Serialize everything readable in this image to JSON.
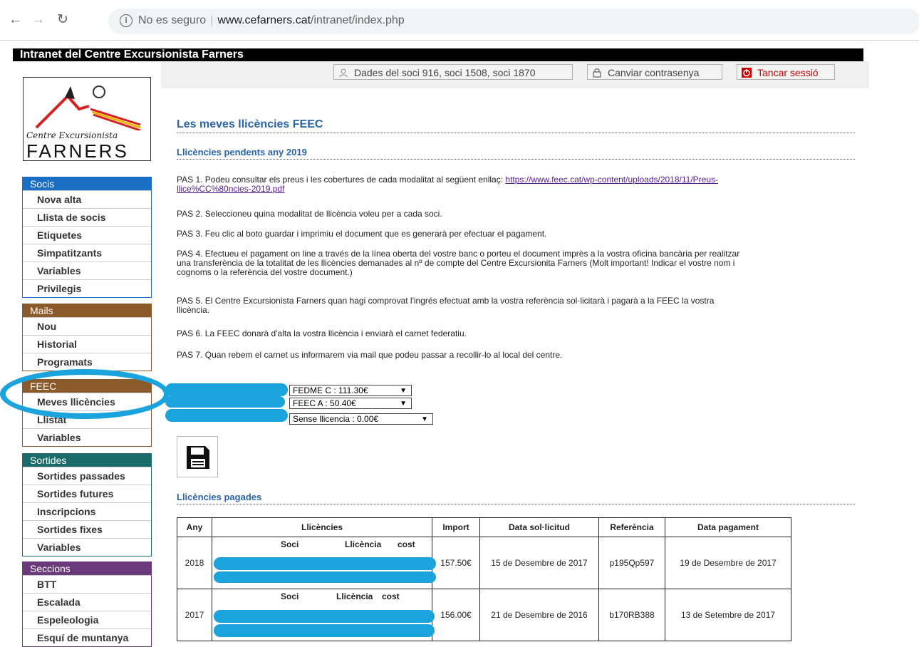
{
  "browser": {
    "security_label": "No es seguro",
    "url_host": "www.cefarners.cat",
    "url_path": "/intranet/index.php"
  },
  "app": {
    "title": "Intranet del Centre Excursionista Farners",
    "logo_line1": "Centre Excursionista",
    "logo_line2": "FARNERS"
  },
  "toolbar": {
    "member_data": "Dades del soci 916, soci 1508, soci 1870",
    "change_password": "Canviar contrasenya",
    "logout": "Tancar sessió"
  },
  "sidebar": {
    "socis": {
      "title": "Socis",
      "items": [
        "Nova alta",
        "Llista de socis",
        "Etiquetes",
        "Simpatitzants",
        "Variables",
        "Privilegis"
      ]
    },
    "mails": {
      "title": "Mails",
      "items": [
        "Nou",
        "Historial",
        "Programats"
      ]
    },
    "feec": {
      "title": "FEEC",
      "items": [
        "Meves llicències",
        "Llistat",
        "Variables"
      ]
    },
    "sortides": {
      "title": "Sortides",
      "items": [
        "Sortides passades",
        "Sortides futures",
        "Inscripcions",
        "Sortides fixes",
        "Variables"
      ]
    },
    "seccions": {
      "title": "Seccions",
      "items": [
        "BTT",
        "Escalada",
        "Espeleologia",
        "Esquí de muntanya"
      ]
    }
  },
  "main": {
    "title": "Les meves llicències FEEC",
    "pending_title": "Llicències pendents any 2019",
    "step1": "PAS 1. Podeu consultar els preus i les cobertures de cada modalitat al següent enllaç:",
    "step1_link_a": "https://www.feec.cat/wp-content/uploads/2018/11/Preus-",
    "step1_link_b": "llice%CC%80ncies-2019.pdf",
    "step2": "PAS 2. Seleccioneu quina modalitat de llicència voleu per a cada soci.",
    "step3": "PAS 3. Feu clic al boto guardar i imprimiu el document que es generarà per efectuar el pagament.",
    "step4_a": "PAS 4. Efectueu el pagament on line a través de la línea oberta del vostre banc o porteu el document imprès a la vostra oficina bancària per realitzar",
    "step4_b": "una transferència de la totalitat de les llicències demanades al nº de compte del Centre Excursionita Farners (Molt important! Indicar el vostre nom i",
    "step4_c": "cognoms o la referència del vostre document.)",
    "step5_a": "PAS 5. El Centre Excursionista Farners quan hagi comprovat l'ingrés efectuat amb la vostra referència sol·licitarà i pagarà a la FEEC la vostra",
    "step5_b": "llicència.",
    "step6": "PAS 6. La FEEC donarà d'alta la vostra llicència i enviarà el carnet federatiu.",
    "step7": "PAS 7. Quan rebem el carnet us informarem via mail que podeu passar a recollir-lo al local del centre.",
    "selects": [
      "FEDME C : 111.30€",
      "FEEC A : 50.40€",
      "Sense llicencia : 0.00€"
    ],
    "paid_title": "Llicències pagades"
  },
  "paid_table": {
    "headers": [
      "Any",
      "Llicències",
      "Import",
      "Data sol·licitud",
      "Referència",
      "Data pagament"
    ],
    "sub_headers": [
      "Soci",
      "Llicència",
      "cost"
    ],
    "rows": [
      {
        "year": "2018",
        "amount": "157.50€",
        "request_date": "15 de Desembre de 2017",
        "reference": "p195Qp597",
        "payment_date": "19 de Desembre de 2017"
      },
      {
        "year": "2017",
        "amount": "156.00€",
        "request_date": "21 de Desembre de 2016",
        "reference": "b170RB388",
        "payment_date": "13 de Setembre de 2017"
      }
    ]
  },
  "colors": {
    "socis": "#1a6fc4",
    "mails": "#8b5a2b",
    "feec": "#8b5a2b",
    "sortides": "#1b6b6b",
    "seccions": "#6b3a7a",
    "heading": "#2864a8",
    "redaction": "#1aa3dc"
  }
}
